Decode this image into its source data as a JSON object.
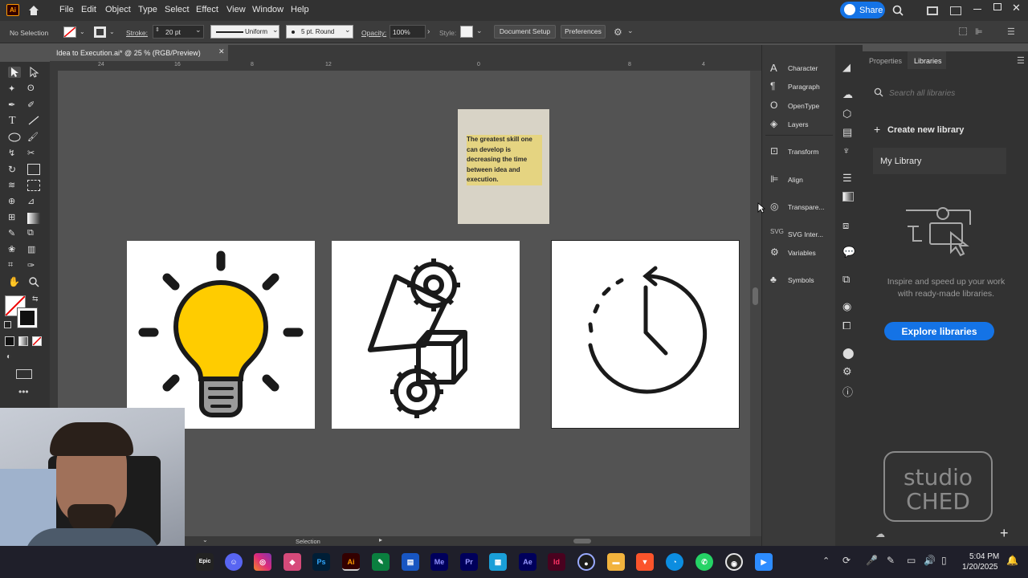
{
  "menubar": {
    "items": [
      "File",
      "Edit",
      "Object",
      "Type",
      "Select",
      "Effect",
      "View",
      "Window",
      "Help"
    ],
    "share_label": "Share"
  },
  "control_bar": {
    "selection": "No Selection",
    "stroke_label": "Stroke:",
    "stroke_value": "20 pt",
    "profile": "Uniform",
    "brush": "5 pt. Round",
    "opacity_label": "Opacity:",
    "opacity_value": "100%",
    "style_label": "Style:",
    "document_setup": "Document Setup",
    "preferences": "Preferences"
  },
  "document": {
    "tab_title": "Idea to Execution.ai* @ 25 % (RGB/Preview)",
    "ruler_ticks": [
      "24",
      "16",
      "8",
      "12",
      "0",
      "8",
      "4"
    ],
    "quote_text": "The greatest skill one can develop is decreasing the time between idea and execution.",
    "status": "Selection"
  },
  "panels": [
    {
      "icon": "character-icon",
      "label": "Character"
    },
    {
      "icon": "paragraph-icon",
      "label": "Paragraph"
    },
    {
      "icon": "opentype-icon",
      "label": "OpenType"
    },
    {
      "icon": "layers-icon",
      "label": "Layers"
    },
    {
      "icon": "transform-icon",
      "label": "Transform"
    },
    {
      "icon": "align-icon",
      "label": "Align"
    },
    {
      "icon": "transparency-icon",
      "label": "Transpare..."
    },
    {
      "icon": "svg-icon",
      "label": "SVG Inter..."
    },
    {
      "icon": "variables-icon",
      "label": "Variables"
    },
    {
      "icon": "symbols-icon",
      "label": "Symbols"
    }
  ],
  "library_panel": {
    "tabs": [
      "Properties",
      "Libraries"
    ],
    "search_placeholder": "Search all libraries",
    "create_label": "Create new library",
    "my_library": "My Library",
    "inspire_text": "Inspire and speed up your work with ready-made libraries.",
    "explore_label": "Explore libraries",
    "watermark_line1": "studio",
    "watermark_line2": "CHED"
  },
  "taskbar": {
    "apps": [
      "Epic",
      "Discord",
      "Instagram",
      "Affinity",
      "Ps",
      "Ai",
      "Express",
      "Word",
      "Me",
      "Pr",
      "Store",
      "Ae",
      "Id",
      "Camera",
      "Files",
      "Brave",
      "Edge",
      "WhatsApp",
      "Chrome",
      "Zoom"
    ],
    "time": "5:04 PM",
    "date": "1/20/2025"
  },
  "colors": {
    "accent": "#1473e6",
    "bulb_yellow": "#ffcc00",
    "ai_orange": "#ff9a00"
  }
}
